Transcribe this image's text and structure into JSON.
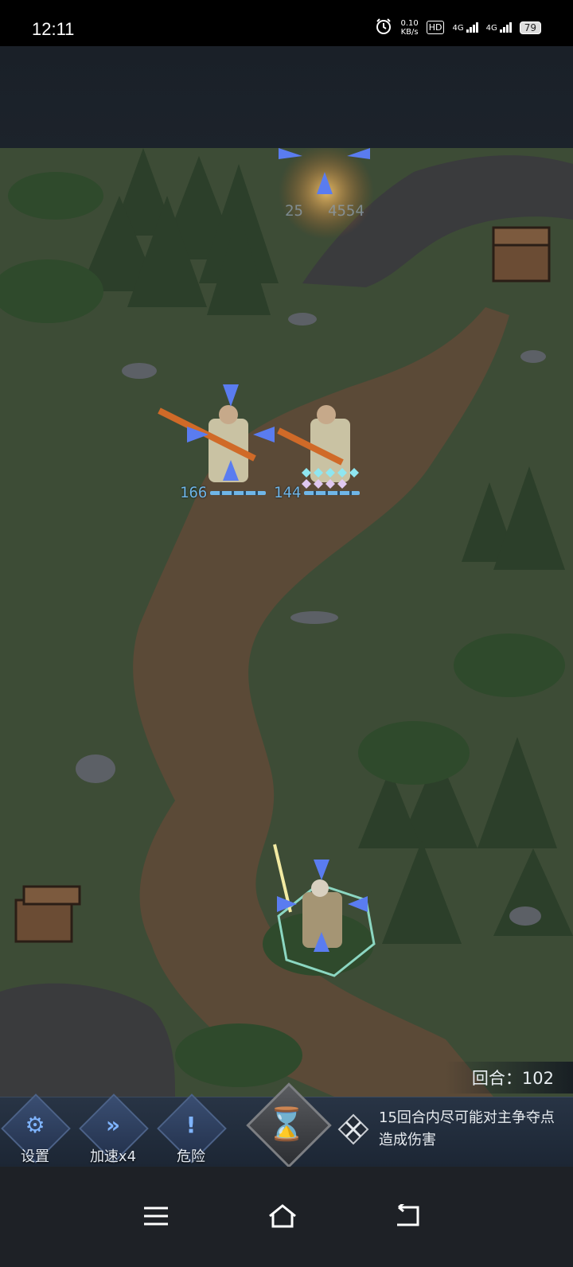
{
  "status_bar": {
    "time": "12:11",
    "net_speed_value": "0.10",
    "net_speed_unit": "KB/s",
    "hd_label": "HD",
    "sim1_label": "4G",
    "sim2_label": "4G",
    "battery": "79"
  },
  "battlefield": {
    "enemy_hp_left": "25",
    "enemy_hp_right": "4554",
    "units": [
      {
        "hp": "166"
      },
      {
        "hp": "144"
      }
    ]
  },
  "round_counter": "回合：102",
  "bottom_bar": {
    "settings_label": "设置",
    "speed_label": "加速x4",
    "danger_label": "危险",
    "objective_line1": "15回合内尽可能对主争夺点",
    "objective_line2": "造成伤害"
  }
}
